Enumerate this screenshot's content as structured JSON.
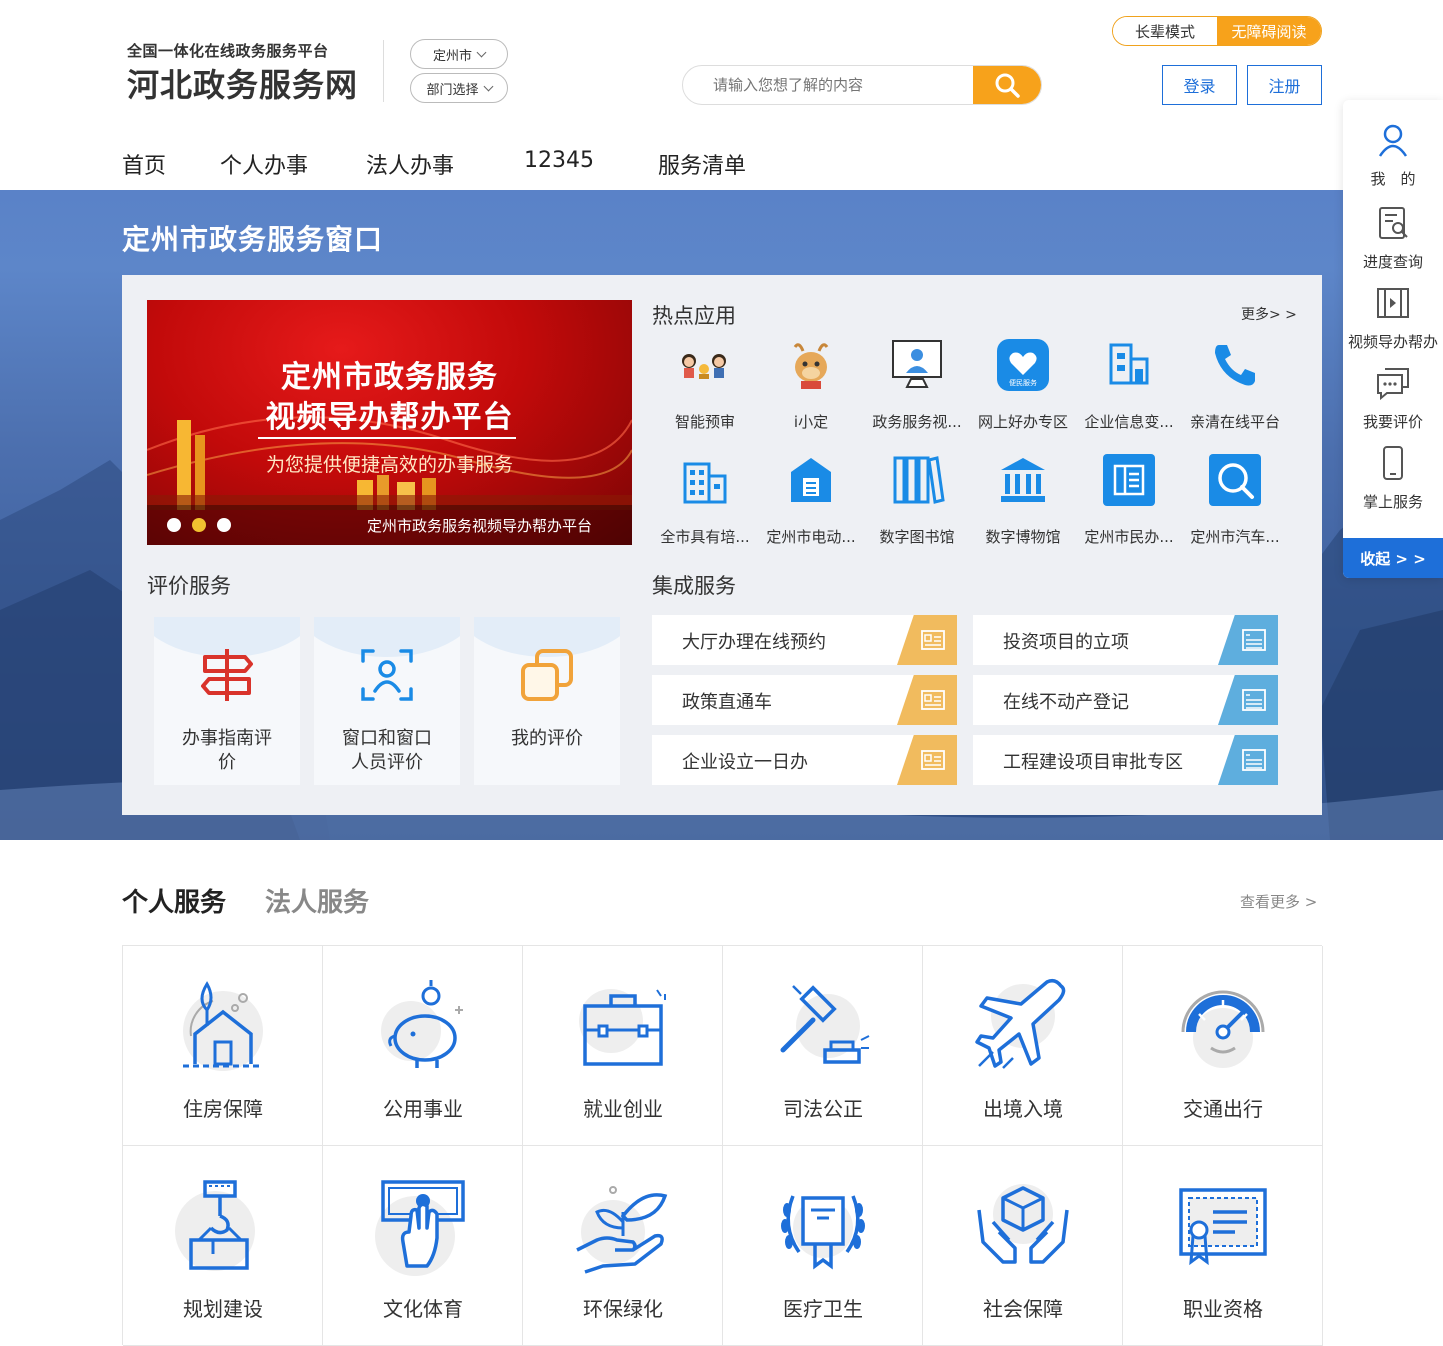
{
  "header": {
    "logo_small": "全国一体化在线政务服务平台",
    "logo_big": "河北政务服务网",
    "city_select": "定州市",
    "dept_select": "部门选择",
    "search_placeholder": "请输入您想了解的内容",
    "mode_elder": "长辈模式",
    "mode_access": "无障碍阅读",
    "login": "登录",
    "register": "注册"
  },
  "nav": [
    "首页",
    "个人办事",
    "法人办事",
    "12345",
    "服务清单"
  ],
  "window_title": "定州市政务服务窗口",
  "slide": {
    "line1": "定州市政务服务",
    "line2": "视频导办帮办平台",
    "subtitle": "为您提供便捷高效的办事服务",
    "caption": "定州市政务服务视频导办帮办平台"
  },
  "hot_apps": {
    "title": "热点应用",
    "more": "更多> >",
    "items": [
      {
        "label": "智能预审",
        "icon": "people-cartoon-icon"
      },
      {
        "label": "i小定",
        "icon": "mascot-icon"
      },
      {
        "label": "政务服务视...",
        "icon": "video-service-icon"
      },
      {
        "label": "网上好办专区",
        "icon": "handshake-icon"
      },
      {
        "label": "企业信息变...",
        "icon": "building-chart-icon"
      },
      {
        "label": "亲清在线平台",
        "icon": "phone-icon"
      },
      {
        "label": "全市具有培...",
        "icon": "office-building-icon"
      },
      {
        "label": "定州市电动...",
        "icon": "house-doc-icon"
      },
      {
        "label": "数字图书馆",
        "icon": "books-icon"
      },
      {
        "label": "数字博物馆",
        "icon": "museum-icon"
      },
      {
        "label": "定州市民办...",
        "icon": "newspaper-icon"
      },
      {
        "label": "定州市汽车...",
        "icon": "search-icon"
      }
    ]
  },
  "evaluation": {
    "title": "评价服务",
    "items": [
      {
        "label": "办事指南评价",
        "icon": "signpost-icon"
      },
      {
        "label": "窗口和窗口人员评价",
        "icon": "person-scan-icon"
      },
      {
        "label": "我的评价",
        "icon": "squares-icon"
      }
    ]
  },
  "integrated": {
    "title": "集成服务",
    "items": [
      {
        "label": "大厅办理在线预约",
        "color": "#f1bb5e"
      },
      {
        "label": "投资项目的立项",
        "color": "#5eaede"
      },
      {
        "label": "政策直通车",
        "color": "#f1bb5e"
      },
      {
        "label": "在线不动产登记",
        "color": "#5eaede"
      },
      {
        "label": "企业设立一日办",
        "color": "#f1bb5e"
      },
      {
        "label": "工程建设项目审批专区",
        "color": "#5eaede"
      }
    ]
  },
  "side_bar": {
    "items": [
      {
        "label": "我　的",
        "icon": "user-icon"
      },
      {
        "label": "进度查询",
        "icon": "progress-search-icon"
      },
      {
        "label": "视频导办帮办",
        "icon": "video-icon"
      },
      {
        "label": "我要评价",
        "icon": "comment-icon"
      },
      {
        "label": "掌上服务",
        "icon": "mobile-icon"
      }
    ],
    "collapse": "收起 > >"
  },
  "services": {
    "tab_personal": "个人服务",
    "tab_legal": "法人服务",
    "more": "查看更多 >",
    "items": [
      {
        "label": "住房保障",
        "icon": "house-plant-icon"
      },
      {
        "label": "公用事业",
        "icon": "piggy-bank-icon"
      },
      {
        "label": "就业创业",
        "icon": "briefcase-icon"
      },
      {
        "label": "司法公正",
        "icon": "gavel-icon"
      },
      {
        "label": "出境入境",
        "icon": "airplane-icon"
      },
      {
        "label": "交通出行",
        "icon": "speedometer-icon"
      },
      {
        "label": "规划建设",
        "icon": "crane-hook-icon"
      },
      {
        "label": "文化体育",
        "icon": "ticket-hand-icon"
      },
      {
        "label": "环保绿化",
        "icon": "plant-hand-icon"
      },
      {
        "label": "医疗卫生",
        "icon": "laurel-certificate-icon"
      },
      {
        "label": "社会保障",
        "icon": "hands-box-icon"
      },
      {
        "label": "职业资格",
        "icon": "certificate-icon"
      }
    ]
  },
  "colors": {
    "brand_blue": "#1e6fd9",
    "accent_orange": "#f7a21b",
    "red": "#d9332b"
  }
}
